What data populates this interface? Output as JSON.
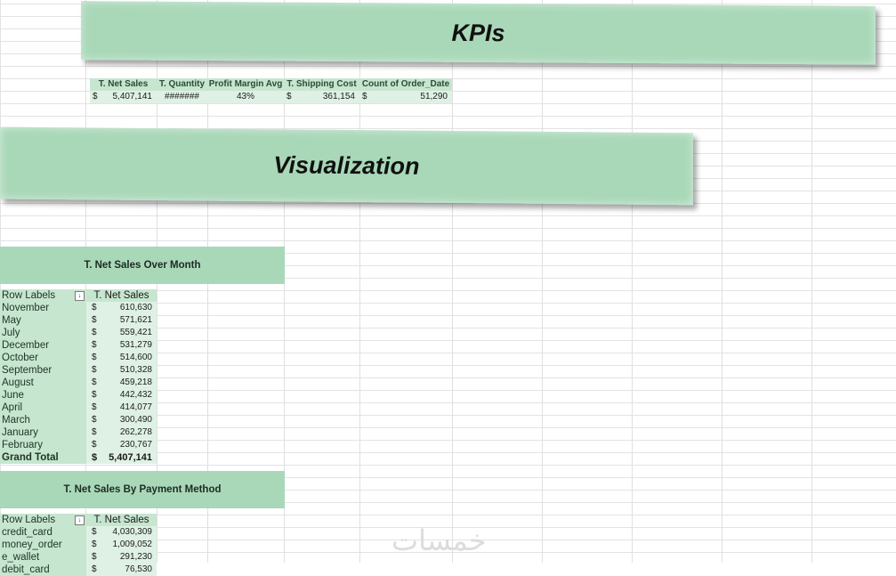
{
  "banners": {
    "kpis": "KPIs",
    "visualization": "Visualization"
  },
  "kpi_table": {
    "headers": [
      "T. Net Sales",
      "T. Quantity",
      "Profit Margin Avg",
      "T. Shipping Cost",
      "Count of Order_Date"
    ],
    "values": {
      "net_sales": {
        "currency": "$",
        "amount": "5,407,141"
      },
      "quantity": "#######",
      "profit_margin": "43%",
      "shipping_cost": {
        "currency": "$",
        "amount": "361,154"
      },
      "order_count": {
        "currency": "$",
        "amount": "51,290"
      }
    }
  },
  "pivot_month": {
    "title": "T. Net Sales Over Month",
    "row_labels_header": "Row Labels",
    "value_header": "T. Net Sales",
    "rows": [
      {
        "label": "November",
        "currency": "$",
        "value": "610,630"
      },
      {
        "label": "May",
        "currency": "$",
        "value": "571,621"
      },
      {
        "label": "July",
        "currency": "$",
        "value": "559,421"
      },
      {
        "label": "December",
        "currency": "$",
        "value": "531,279"
      },
      {
        "label": "October",
        "currency": "$",
        "value": "514,600"
      },
      {
        "label": "September",
        "currency": "$",
        "value": "510,328"
      },
      {
        "label": "August",
        "currency": "$",
        "value": "459,218"
      },
      {
        "label": "June",
        "currency": "$",
        "value": "442,432"
      },
      {
        "label": "April",
        "currency": "$",
        "value": "414,077"
      },
      {
        "label": "March",
        "currency": "$",
        "value": "300,490"
      },
      {
        "label": "January",
        "currency": "$",
        "value": "262,278"
      },
      {
        "label": "February",
        "currency": "$",
        "value": "230,767"
      }
    ],
    "total": {
      "label": "Grand Total",
      "currency": "$",
      "value": "5,407,141"
    }
  },
  "pivot_payment": {
    "title": "T. Net Sales By Payment Method",
    "row_labels_header": "Row Labels",
    "value_header": "T. Net Sales",
    "rows": [
      {
        "label": "credit_card",
        "currency": "$",
        "value": "4,030,309"
      },
      {
        "label": "money_order",
        "currency": "$",
        "value": "1,009,052"
      },
      {
        "label": "e_wallet",
        "currency": "$",
        "value": "291,230"
      },
      {
        "label": "debit_card",
        "currency": "$",
        "value": "76,530"
      }
    ]
  },
  "watermark": "خمسات",
  "icons": {
    "filter_sort": "filter-sort-icon"
  },
  "colors": {
    "banner": "#a9d8b8",
    "header_fill": "#c6e6cf",
    "value_fill": "#dff1e4"
  }
}
